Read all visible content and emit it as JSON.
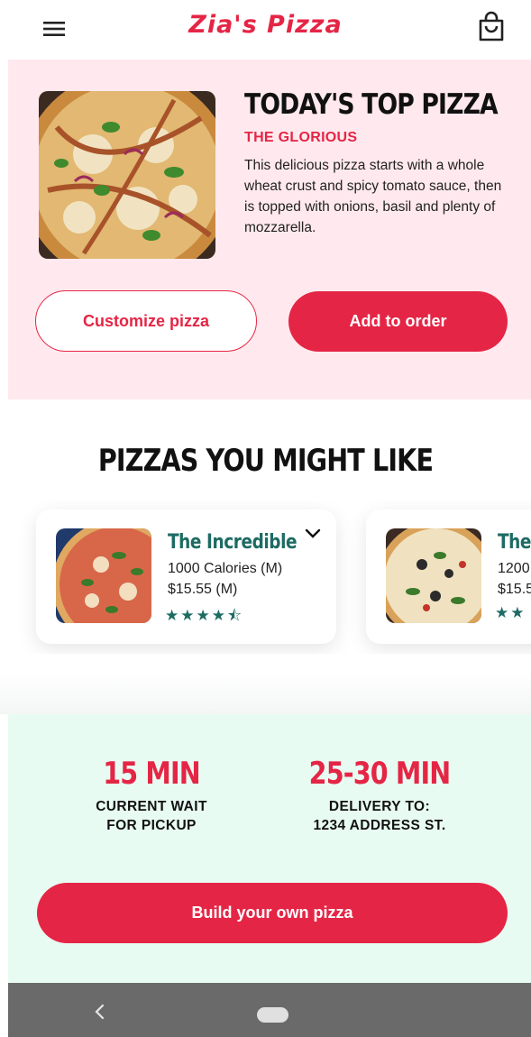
{
  "app": {
    "brand": "Zia's Pizza",
    "icons": {
      "menu": "hamburger-menu-icon",
      "cart": "shopping-bag-icon"
    }
  },
  "featured": {
    "title": "TODAY'S TOP PIZZA",
    "subtitle": "THE GLORIOUS",
    "description": "This delicious pizza starts with a whole wheat crust and spicy tomato sauce, then is topped with onions, basil and plenty of mozzarella.",
    "image": "bbq-chicken-pizza-image",
    "customize_label": "Customize pizza",
    "add_label": "Add to order"
  },
  "recommendations": {
    "title": "PIZZAS YOU MIGHT LIKE",
    "items": [
      {
        "name": "The Incredible",
        "calories": "1000 Calories (M)",
        "price": "$15.55 (M)",
        "rating": 4.5,
        "image": "margherita-pizza-image"
      },
      {
        "name": "The",
        "calories": "1200",
        "price": "$15.5",
        "rating": 2,
        "image": "veggie-pizza-image"
      }
    ]
  },
  "status": {
    "pickup": {
      "value": "15 MIN",
      "line1": "CURRENT WAIT",
      "line2": "FOR PICKUP"
    },
    "delivery": {
      "value": "25-30 MIN",
      "line1": "DELIVERY TO:",
      "line2": "1234 ADDRESS ST."
    }
  },
  "build_label": "Build your own pizza",
  "colors": {
    "accent": "#e52545",
    "teal": "#1d6b63",
    "featured_bg": "#ffe9ee",
    "status_bg": "#e8fbf2",
    "nav_bg": "#6a6a6a"
  }
}
